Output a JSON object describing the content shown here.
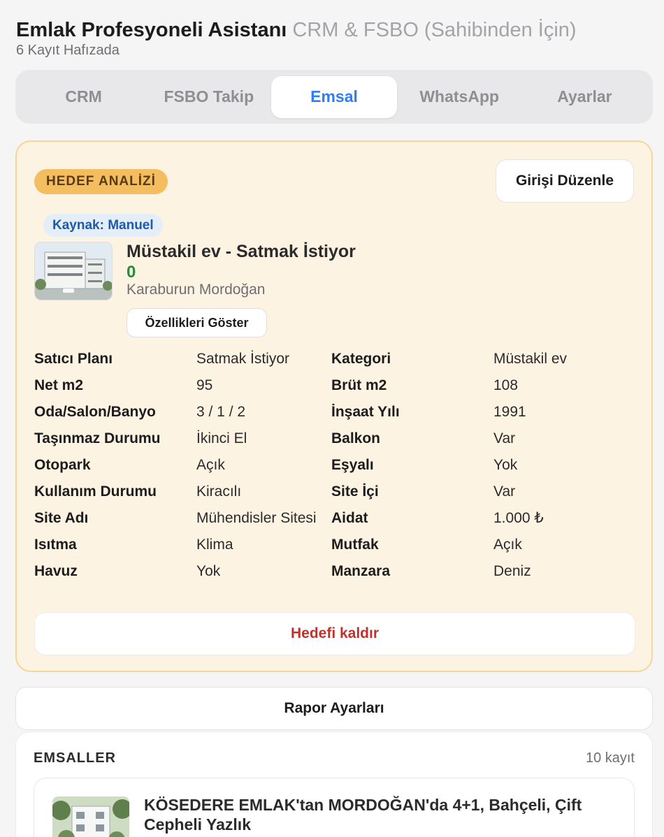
{
  "header": {
    "title": "Emlak Profesyoneli Asistanı",
    "title_suffix": "CRM & FSBO (Sahibinden İçin)",
    "subtitle": "6 Kayıt Hafızada"
  },
  "tabs": [
    {
      "label": "CRM",
      "active": false
    },
    {
      "label": "FSBO Takip",
      "active": false
    },
    {
      "label": "Emsal",
      "active": true
    },
    {
      "label": "WhatsApp",
      "active": false
    },
    {
      "label": "Ayarlar",
      "active": false
    }
  ],
  "target": {
    "badge": "HEDEF ANALİZİ",
    "edit_button": "Girişi Düzenle",
    "source": "Kaynak: Manuel",
    "title": "Müstakil ev - Satmak İstiyor",
    "price": "0",
    "location": "Karaburun Mordoğan",
    "features_button": "Özellikleri Göster",
    "properties": [
      {
        "k1": "Satıcı Planı",
        "v1": "Satmak İstiyor",
        "k2": "Kategori",
        "v2": "Müstakil ev"
      },
      {
        "k1": "Net m2",
        "v1": "95",
        "k2": "Brüt m2",
        "v2": "108"
      },
      {
        "k1": "Oda/Salon/Banyo",
        "v1": "3 / 1 / 2",
        "k2": "İnşaat Yılı",
        "v2": "1991"
      },
      {
        "k1": "Taşınmaz Durumu",
        "v1": "İkinci El",
        "k2": "Balkon",
        "v2": "Var"
      },
      {
        "k1": "Otopark",
        "v1": "Açık",
        "k2": "Eşyalı",
        "v2": "Yok"
      },
      {
        "k1": "Kullanım Durumu",
        "v1": "Kiracılı",
        "k2": "Site İçi",
        "v2": "Var"
      },
      {
        "k1": "Site Adı",
        "v1": "Mühendisler Sitesi",
        "k2": "Aidat",
        "v2": "1.000 ₺"
      },
      {
        "k1": "Isıtma",
        "v1": "Klima",
        "k2": "Mutfak",
        "v2": "Açık"
      },
      {
        "k1": "Havuz",
        "v1": "Yok",
        "k2": "Manzara",
        "v2": "Deniz"
      }
    ],
    "remove_button": "Hedefi kaldır"
  },
  "report_button": "Rapor Ayarları",
  "comparables": {
    "title": "EMSALLER",
    "count": "10 kayıt",
    "items": [
      {
        "title": "KÖSEDERE EMLAK'tan MORDOĞAN'da 4+1, Bahçeli, Çift Cepheli Yazlık"
      }
    ]
  },
  "colors": {
    "accent": "#2f7cf6",
    "target_bg": "#fdf3e2",
    "badge": "#f4bd5f",
    "price": "#2e8a3b",
    "danger": "#c0312b"
  }
}
